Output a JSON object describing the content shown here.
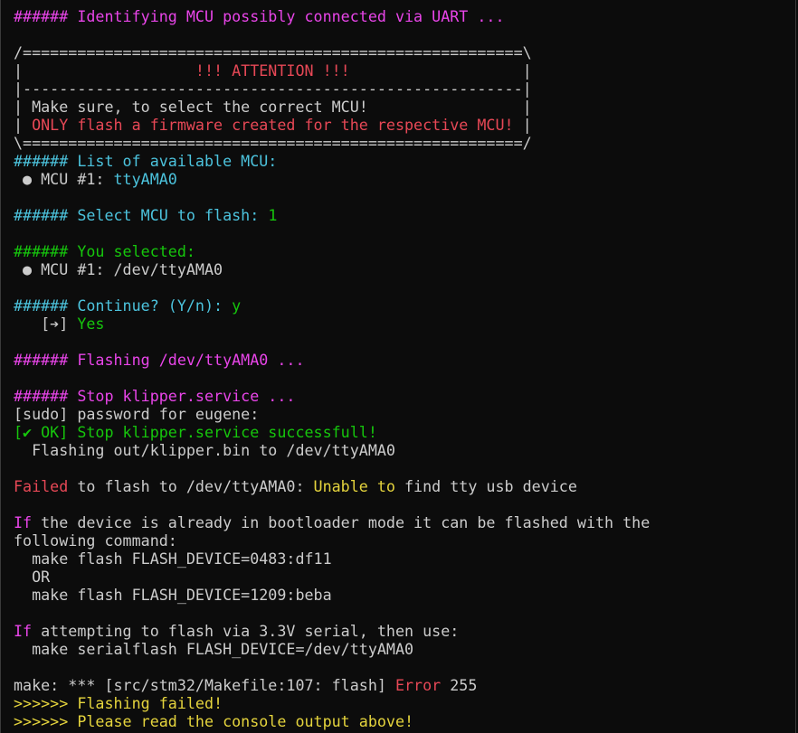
{
  "colors": {
    "background": "#0c0c0c",
    "text": "#cccccc",
    "magenta": "#e945e9",
    "cyan": "#4cc3dd",
    "green": "#16c60c",
    "red": "#e74856",
    "yellow": "#e5d43d"
  },
  "lines": [
    [
      {
        "c": "magenta",
        "t": "###### Identifying MCU possibly connected via UART ..."
      }
    ],
    [],
    [
      {
        "c": "gray",
        "t": "/=======================================================\\"
      }
    ],
    [
      {
        "c": "gray",
        "t": "|"
      },
      {
        "c": "red",
        "t": "                   !!! ATTENTION !!!                   "
      },
      {
        "c": "gray",
        "t": "|"
      }
    ],
    [
      {
        "c": "gray",
        "t": "|-------------------------------------------------------|"
      }
    ],
    [
      {
        "c": "gray",
        "t": "| Make sure, to select the correct MCU!                 |"
      }
    ],
    [
      {
        "c": "gray",
        "t": "| "
      },
      {
        "c": "red",
        "t": "ONLY flash a firmware created for the respective MCU!"
      },
      {
        "c": "gray",
        "t": " |"
      }
    ],
    [
      {
        "c": "gray",
        "t": "\\=======================================================/"
      }
    ],
    [
      {
        "c": "cyan",
        "t": "###### List of available MCU:"
      }
    ],
    [
      {
        "c": "gray",
        "t": " ● MCU #1: "
      },
      {
        "c": "cyan",
        "t": "ttyAMA0"
      }
    ],
    [],
    [
      {
        "c": "cyan",
        "t": "###### Select MCU to flash: "
      },
      {
        "c": "green",
        "t": "1"
      }
    ],
    [],
    [
      {
        "c": "green",
        "t": "###### You selected:"
      }
    ],
    [
      {
        "c": "gray",
        "t": " ● MCU #1: /dev/ttyAMA0"
      }
    ],
    [],
    [
      {
        "c": "cyan",
        "t": "###### Continue? (Y/n): "
      },
      {
        "c": "green",
        "t": "y"
      }
    ],
    [
      {
        "c": "gray",
        "t": "   [➔] "
      },
      {
        "c": "green",
        "t": "Yes"
      }
    ],
    [],
    [
      {
        "c": "magenta",
        "t": "###### Flashing /dev/ttyAMA0 ..."
      }
    ],
    [],
    [
      {
        "c": "magenta",
        "t": "###### Stop klipper.service ..."
      }
    ],
    [
      {
        "c": "gray",
        "t": "[sudo] password for eugene:"
      }
    ],
    [
      {
        "c": "green",
        "t": "[✔ OK] Stop klipper.service successfull!"
      }
    ],
    [
      {
        "c": "gray",
        "t": "  Flashing out/klipper.bin to /dev/ttyAMA0"
      }
    ],
    [],
    [
      {
        "c": "red",
        "t": "Failed"
      },
      {
        "c": "gray",
        "t": " to flash to /dev/ttyAMA0: "
      },
      {
        "c": "yellow",
        "t": "Unable to"
      },
      {
        "c": "gray",
        "t": " find tty usb device"
      }
    ],
    [],
    [
      {
        "c": "magenta",
        "t": "If"
      },
      {
        "c": "gray",
        "t": " the device is already in bootloader mode it can be flashed with the"
      }
    ],
    [
      {
        "c": "gray",
        "t": "following command:"
      }
    ],
    [
      {
        "c": "gray",
        "t": "  make flash FLASH_DEVICE=0483:df11"
      }
    ],
    [
      {
        "c": "gray",
        "t": "  OR"
      }
    ],
    [
      {
        "c": "gray",
        "t": "  make flash FLASH_DEVICE=1209:beba"
      }
    ],
    [],
    [
      {
        "c": "magenta",
        "t": "If"
      },
      {
        "c": "gray",
        "t": " attempting to flash via 3.3V serial, then use:"
      }
    ],
    [
      {
        "c": "gray",
        "t": "  make serialflash FLASH_DEVICE=/dev/ttyAMA0"
      }
    ],
    [],
    [
      {
        "c": "gray",
        "t": "make: *** [src/stm32/Makefile:107: flash] "
      },
      {
        "c": "red",
        "t": "Error"
      },
      {
        "c": "gray",
        "t": " 255"
      }
    ],
    [
      {
        "c": "yellow",
        "t": ">>>>>> Flashing failed!"
      }
    ],
    [
      {
        "c": "yellow",
        "t": ">>>>>> Please read the console output above!"
      }
    ]
  ]
}
